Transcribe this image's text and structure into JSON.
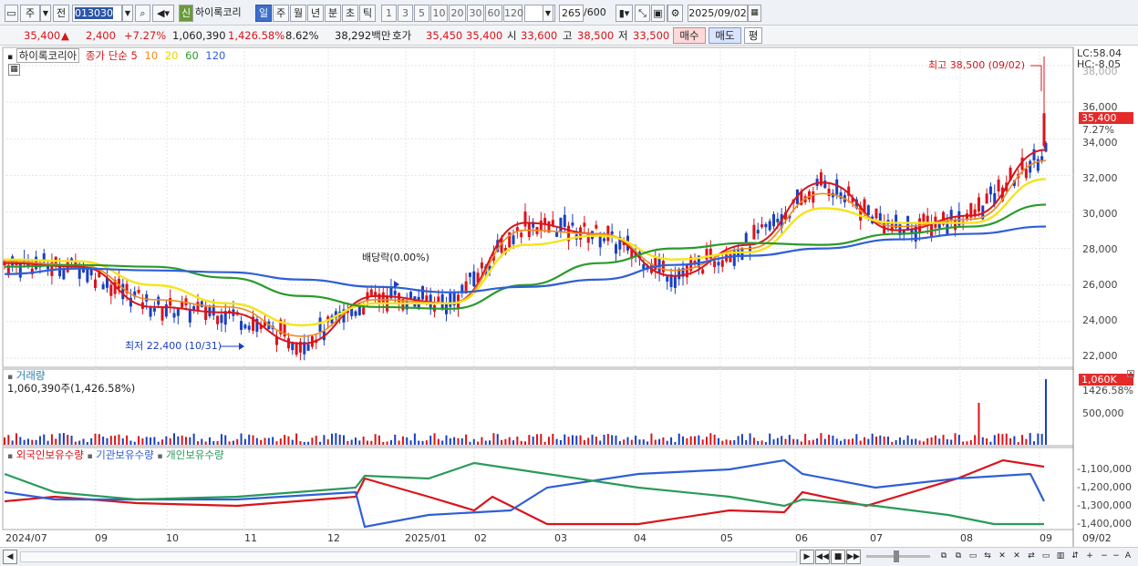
{
  "toolbar": {
    "market": "주",
    "prev": "전",
    "code": "013030",
    "new_badge": "신",
    "stock_name": "하이록코리",
    "periods": [
      "일",
      "주",
      "월",
      "년",
      "분",
      "초",
      "틱"
    ],
    "selected_period": "일",
    "intervals": [
      "1",
      "3",
      "5",
      "10",
      "20",
      "30",
      "60",
      "120"
    ],
    "count": "265",
    "count_max": "/600",
    "date": "2025/09/02"
  },
  "info": {
    "price": "35,400",
    "change_arrow": "▲",
    "change": "2,400",
    "change_pct": "+7.27%",
    "volume": "1,060,390",
    "volume_pct": "1,426.58%",
    "turnover": "8.62%",
    "amount": "38,292백만",
    "bid_label": "호가",
    "bid": "35,450",
    "ask": "35,400",
    "open_label": "시",
    "open": "33,600",
    "high_label": "고",
    "high": "38,500",
    "low_label": "저",
    "low": "33,500",
    "buy": "매수",
    "sell": "매도",
    "avg": "평"
  },
  "price_panel": {
    "name": "하이록코리아",
    "ma_label": "종가 단순",
    "ma_periods": [
      "5",
      "10",
      "20",
      "60",
      "120"
    ],
    "lc": "LC:58.04",
    "hc": "HC:-8.05",
    "max_note": "최고 38,500 (09/02)",
    "min_note": "최저 22,400 (10/31)",
    "dividend_note": "배당락(0.00%)",
    "current_price": "35,400",
    "current_pct": "7.27%",
    "ticks": [
      "36,000",
      "34,000",
      "32,000",
      "30,000",
      "28,000",
      "26,000",
      "24,000",
      "22,000"
    ],
    "top_tick_partial": "38,000"
  },
  "volume_panel": {
    "title": "거래량",
    "value": "1,060,390주(1,426.58%)",
    "box": "1,060K",
    "box_pct": "1426.58%",
    "tick": "500,000"
  },
  "holder_panel": {
    "legend": [
      "외국인보유수량",
      "기관보유수량",
      "개인보유수량"
    ],
    "ticks": [
      "-1,100,000",
      "-1,200,000",
      "-1,300,000",
      "-1,400,000"
    ]
  },
  "x_axis": {
    "labels": [
      "2024/07",
      "09",
      "10",
      "11",
      "12",
      "2025/01",
      "02",
      "03",
      "04",
      "05",
      "06",
      "07",
      "08",
      "09"
    ],
    "right_label": "09/02"
  },
  "colors": {
    "up": "#d9141b",
    "down": "#1a3fbf",
    "ma5": "#d9141b",
    "ma10": "#f08a1c",
    "ma20": "#f5e41a",
    "ma60": "#2a9a2a",
    "ma120": "#2f5fd6",
    "foreign": "#d9141b",
    "institution": "#2f5fd6",
    "individual": "#2a9a5a"
  },
  "chart_data": {
    "type": "line",
    "series": [
      {
        "name": "5",
        "x": [
          "2024/07",
          "2024/08",
          "2024/09",
          "2024/10",
          "2024/11",
          "2024/12",
          "2025/01",
          "2025/02",
          "2025/03",
          "2025/04",
          "2025/05",
          "2025/06",
          "2025/07",
          "2025/08",
          "2025/09"
        ],
        "values": [
          27200,
          27000,
          24800,
          24500,
          22800,
          25400,
          25000,
          29400,
          28800,
          26500,
          28200,
          31600,
          29000,
          29800,
          33400
        ]
      },
      {
        "name": "10",
        "x": [
          "2024/07",
          "2024/08",
          "2024/09",
          "2024/10",
          "2024/11",
          "2024/12",
          "2025/01",
          "2025/02",
          "2025/03",
          "2025/04",
          "2025/05",
          "2025/06",
          "2025/07",
          "2025/08",
          "2025/09"
        ],
        "values": [
          27300,
          27100,
          25200,
          24800,
          23200,
          25200,
          25000,
          29000,
          28800,
          26800,
          28000,
          31000,
          29200,
          29600,
          32800
        ]
      },
      {
        "name": "20",
        "x": [
          "2024/07",
          "2024/08",
          "2024/09",
          "2024/10",
          "2024/11",
          "2024/12",
          "2025/01",
          "2025/02",
          "2025/03",
          "2025/04",
          "2025/05",
          "2025/06",
          "2025/07",
          "2025/08",
          "2025/09"
        ],
        "values": [
          27400,
          27300,
          26000,
          25000,
          23800,
          25000,
          25000,
          28200,
          28700,
          27400,
          27800,
          30200,
          29400,
          29400,
          31800
        ]
      },
      {
        "name": "60",
        "x": [
          "2024/07",
          "2024/08",
          "2024/09",
          "2024/10",
          "2024/11",
          "2024/12",
          "2025/01",
          "2025/02",
          "2025/03",
          "2025/04",
          "2025/05",
          "2025/06",
          "2025/07",
          "2025/08",
          "2025/09"
        ],
        "values": [
          27000,
          27100,
          27000,
          26400,
          25400,
          24800,
          24700,
          26000,
          27200,
          28000,
          28300,
          28200,
          28800,
          29200,
          30400
        ]
      },
      {
        "name": "120",
        "x": [
          "2024/07",
          "2024/08",
          "2024/09",
          "2024/10",
          "2024/11",
          "2024/12",
          "2025/01",
          "2025/02",
          "2025/03",
          "2025/04",
          "2025/05",
          "2025/06",
          "2025/07",
          "2025/08",
          "2025/09"
        ],
        "values": [
          26600,
          26900,
          26800,
          26700,
          26300,
          25900,
          25600,
          25900,
          26300,
          27100,
          27600,
          28000,
          28500,
          28800,
          29200
        ]
      }
    ],
    "xlabel": "",
    "ylabel": "",
    "ylim": [
      21500,
      39000
    ],
    "grid": true,
    "legend": "top-left"
  }
}
